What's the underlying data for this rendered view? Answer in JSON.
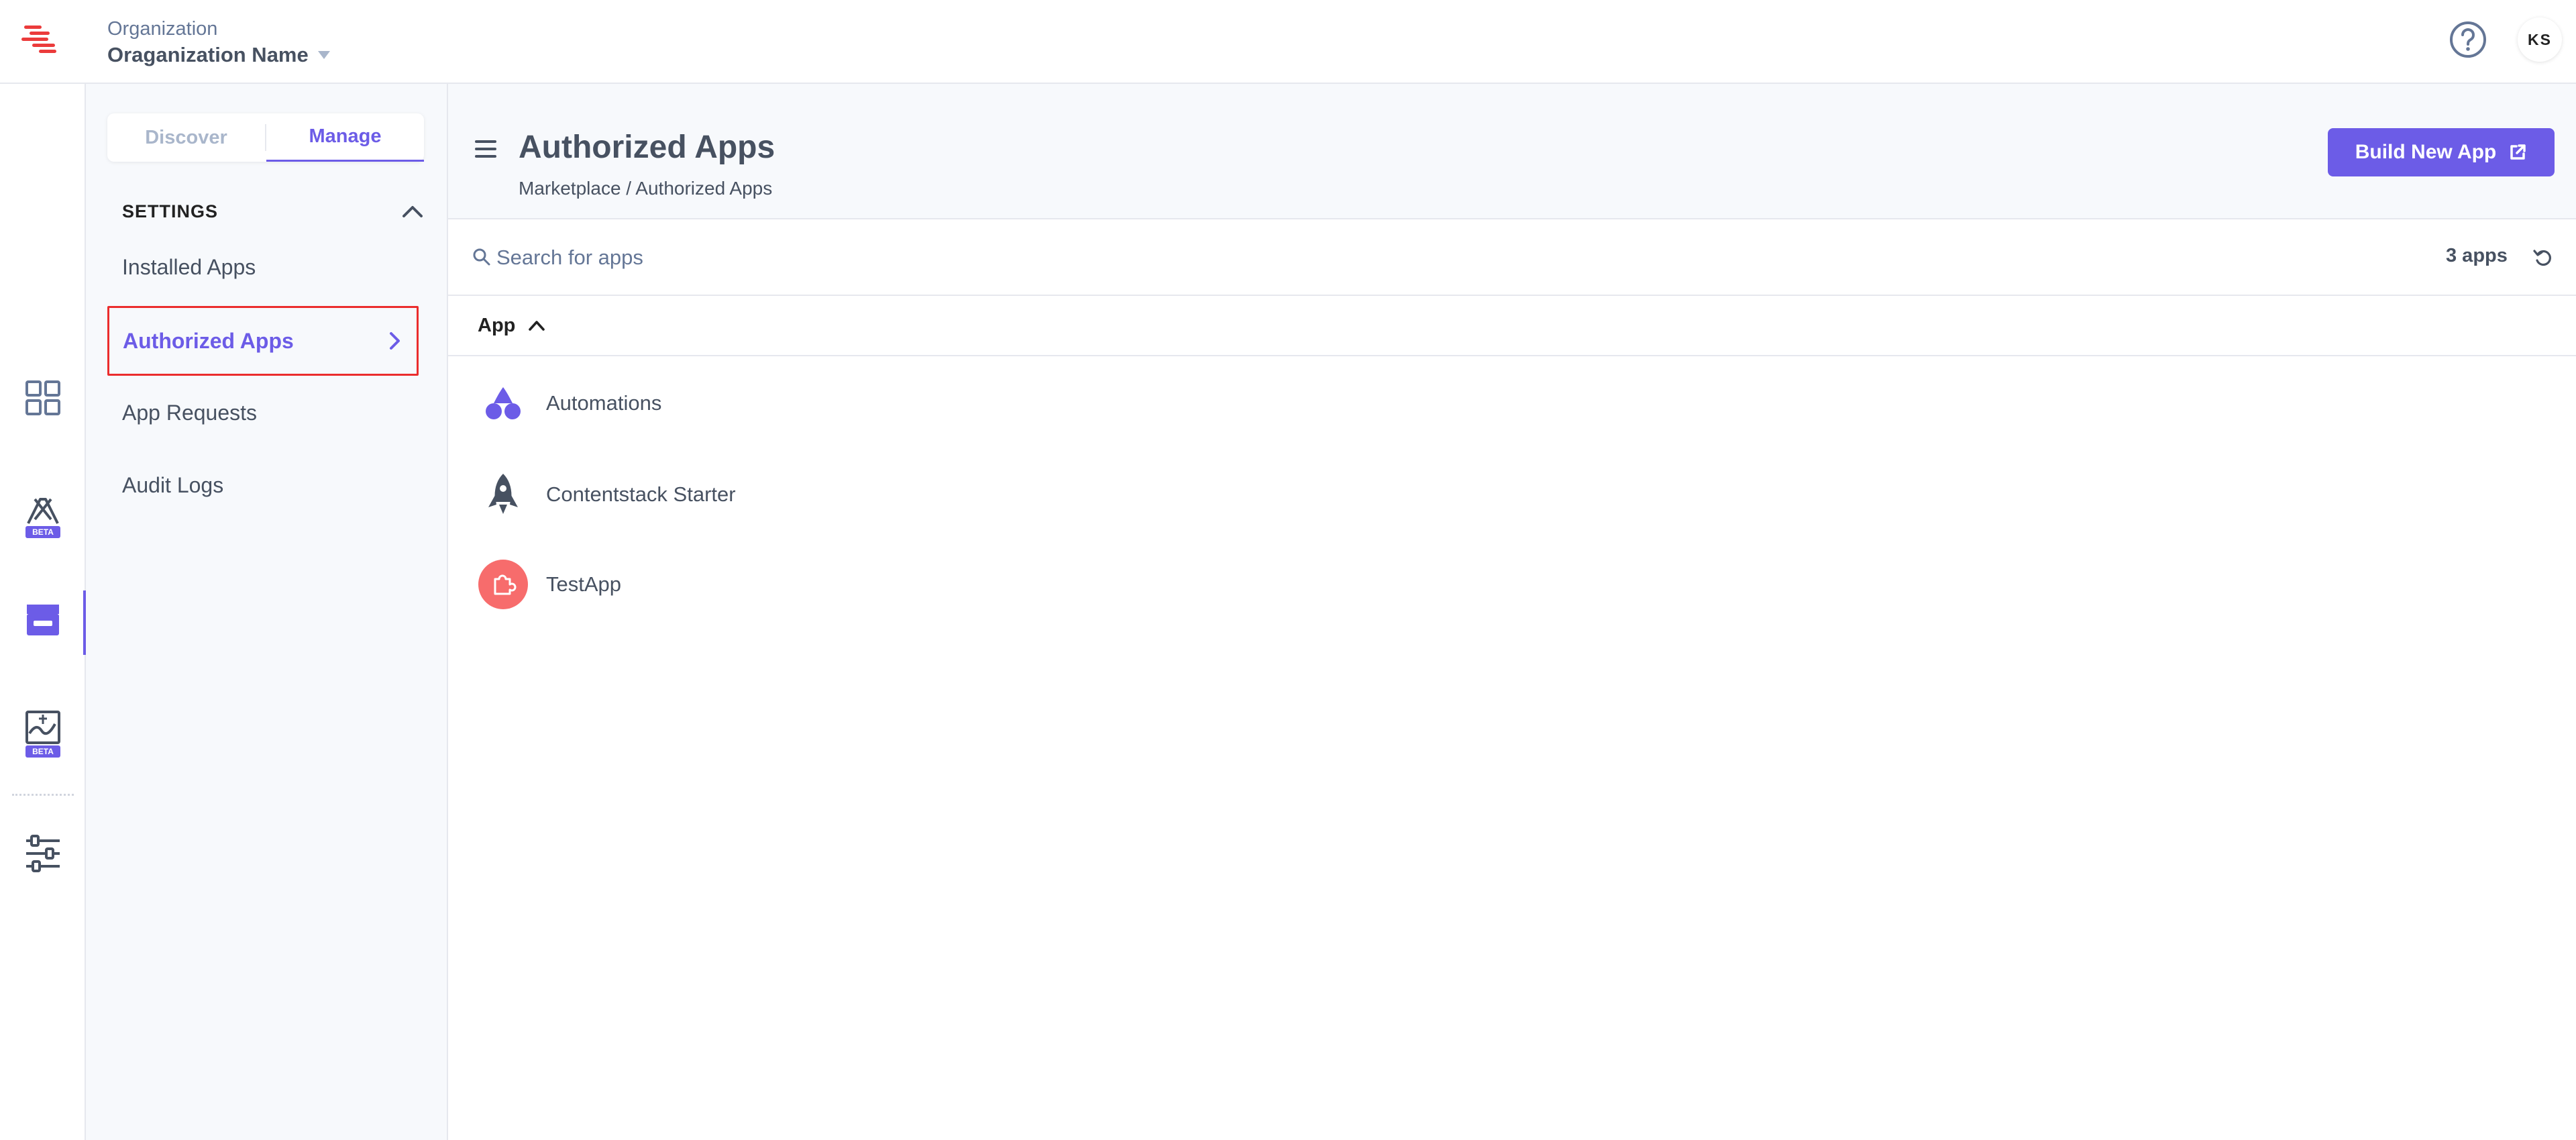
{
  "header": {
    "org_label": "Organization",
    "org_name": "Oraganization Name",
    "avatar_initials": "KS"
  },
  "rail": {
    "items": [
      {
        "icon": "dashboard-icon"
      },
      {
        "icon": "automations-beta-icon",
        "badge": "BETA"
      },
      {
        "icon": "marketplace-icon",
        "active": true
      },
      {
        "icon": "launch-beta-icon",
        "badge": "BETA"
      },
      {
        "icon": "settings-sliders-icon"
      }
    ]
  },
  "sidebar": {
    "tabs": [
      {
        "label": "Discover",
        "active": false
      },
      {
        "label": "Manage",
        "active": true
      }
    ],
    "section_title": "SETTINGS",
    "items": [
      {
        "label": "Installed Apps"
      },
      {
        "label": "Authorized Apps",
        "active": true
      },
      {
        "label": "App Requests"
      },
      {
        "label": "Audit Logs"
      }
    ]
  },
  "page": {
    "title": "Authorized Apps",
    "breadcrumb": "Marketplace / Authorized Apps",
    "build_button": "Build New App"
  },
  "search": {
    "placeholder": "Search for apps",
    "count": "3 apps"
  },
  "table": {
    "column": "App",
    "rows": [
      {
        "name": "Automations",
        "icon": "automations-app-icon"
      },
      {
        "name": "Contentstack Starter",
        "icon": "rocket-app-icon"
      },
      {
        "name": "TestApp",
        "icon": "puzzle-app-icon"
      }
    ]
  },
  "colors": {
    "accent": "#6c5ce7",
    "highlight_border": "#eb2d2d",
    "text_primary": "#475161",
    "text_muted": "#647696",
    "testapp_bg": "#f76c6c",
    "logo_red": "#eb3b3b"
  }
}
